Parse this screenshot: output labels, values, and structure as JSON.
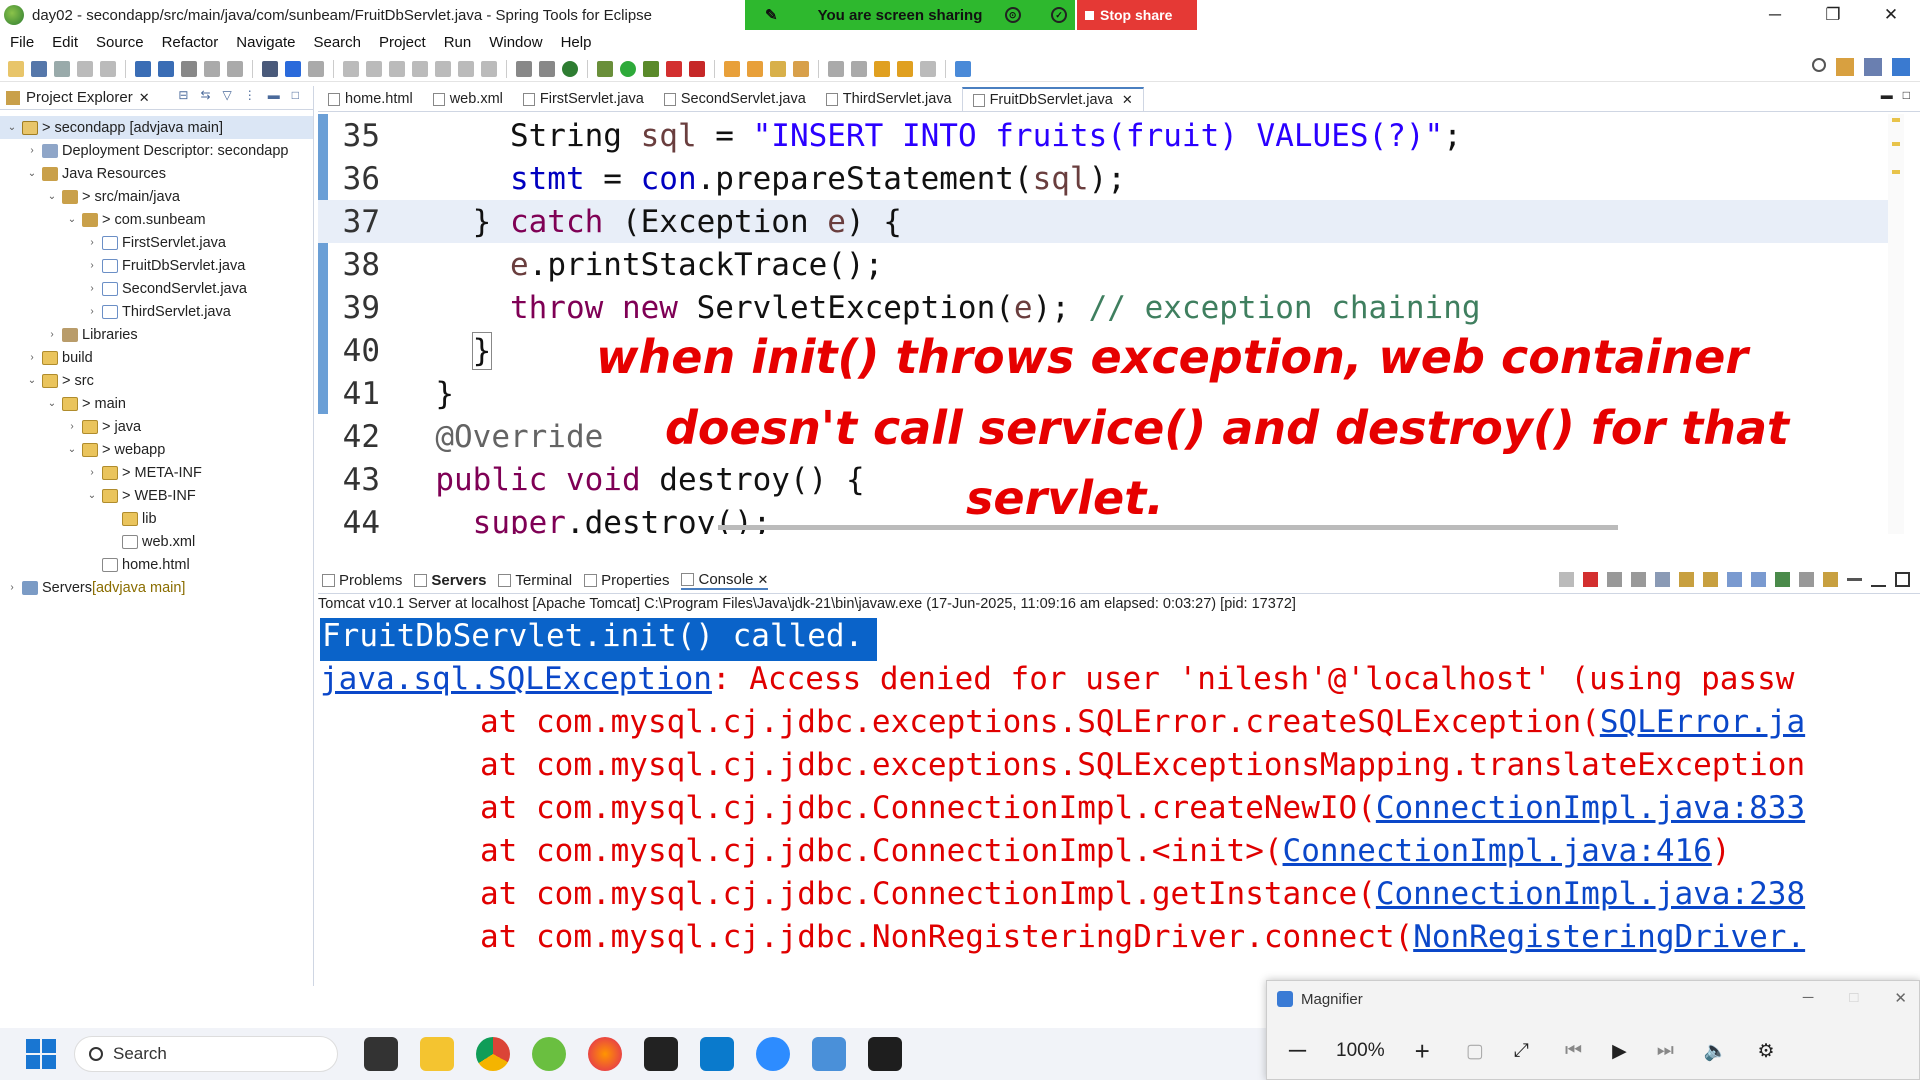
{
  "window": {
    "title": "day02 - secondapp/src/main/java/com/sunbeam/FruitDbServlet.java - Spring Tools for Eclipse",
    "controls": {
      "minimize": "─",
      "maximize": "❐",
      "close": "✕"
    }
  },
  "share_banner": {
    "text": "You are screen sharing",
    "stop_label": "Stop share",
    "color": "#2eb82e",
    "stop_color": "#e53935"
  },
  "menu": [
    "File",
    "Edit",
    "Source",
    "Refactor",
    "Navigate",
    "Search",
    "Project",
    "Run",
    "Window",
    "Help"
  ],
  "explorer": {
    "tab_label": "Project Explorer",
    "items": [
      {
        "label": "> secondapp [advjava main]",
        "icon": "project-icon",
        "twisty": "⌄"
      },
      {
        "label": "Deployment Descriptor: secondapp",
        "icon": "descriptor-icon",
        "twisty": "›"
      },
      {
        "label": "Java Resources",
        "icon": "java-resources-icon",
        "twisty": "⌄"
      },
      {
        "label": "> src/main/java",
        "icon": "source-folder-icon",
        "twisty": "⌄"
      },
      {
        "label": "> com.sunbeam",
        "icon": "package-icon",
        "twisty": "⌄"
      },
      {
        "label": "FirstServlet.java",
        "icon": "java-file-icon",
        "twisty": "›"
      },
      {
        "label": "FruitDbServlet.java",
        "icon": "java-file-icon",
        "twisty": "›"
      },
      {
        "label": "SecondServlet.java",
        "icon": "java-file-icon",
        "twisty": "›"
      },
      {
        "label": "ThirdServlet.java",
        "icon": "java-file-icon",
        "twisty": "›"
      },
      {
        "label": "Libraries",
        "icon": "library-icon",
        "twisty": "›"
      },
      {
        "label": "build",
        "icon": "folder-icon",
        "twisty": "›"
      },
      {
        "label": "> src",
        "icon": "folder-icon",
        "twisty": "⌄"
      },
      {
        "label": "> main",
        "icon": "folder-icon",
        "twisty": "⌄"
      },
      {
        "label": "> java",
        "icon": "folder-icon",
        "twisty": "›"
      },
      {
        "label": "> webapp",
        "icon": "folder-icon",
        "twisty": "⌄"
      },
      {
        "label": "> META-INF",
        "icon": "folder-icon",
        "twisty": "›"
      },
      {
        "label": "> WEB-INF",
        "icon": "folder-icon",
        "twisty": "⌄"
      },
      {
        "label": "lib",
        "icon": "folder-icon",
        "twisty": ""
      },
      {
        "label": "web.xml",
        "icon": "xml-file-icon",
        "twisty": ""
      },
      {
        "label": "home.html",
        "icon": "html-file-icon",
        "twisty": ""
      },
      {
        "label": "Servers",
        "decor": " [advjava main]",
        "icon": "servers-icon",
        "twisty": "›"
      }
    ]
  },
  "editor": {
    "tabs": [
      {
        "label": "home.html",
        "active": false
      },
      {
        "label": "web.xml",
        "active": false
      },
      {
        "label": "FirstServlet.java",
        "active": false
      },
      {
        "label": "SecondServlet.java",
        "active": false
      },
      {
        "label": "ThirdServlet.java",
        "active": false
      },
      {
        "label": "FruitDbServlet.java",
        "active": true
      }
    ],
    "line_numbers": [
      "35",
      "36",
      "37",
      "38",
      "39",
      "40",
      "41",
      "42",
      "43",
      "44"
    ],
    "annotation": {
      "line1": "when init() throws exception, web container",
      "line2": "doesn't call service() and destroy() for that",
      "line3": "servlet."
    }
  },
  "console_panel": {
    "tabs": [
      "Problems",
      "Servers",
      "Terminal",
      "Properties",
      "Console"
    ],
    "description": "Tomcat v10.1 Server at localhost [Apache Tomcat] C:\\Program Files\\Java\\jdk-21\\bin\\javaw.exe  (17-Jun-2025, 11:09:16 am elapsed: 0:03:27) [pid: 17372]",
    "lines": {
      "l0": "FruitDbServlet.init() called.",
      "l1_link": "java.sql.SQLException",
      "l1_text": ": Access denied for user 'nilesh'@'localhost' (using passw",
      "l2_text": "at com.mysql.cj.jdbc.exceptions.SQLError.createSQLException(",
      "l2_link": "SQLError.ja",
      "l3_text": "at com.mysql.cj.jdbc.exceptions.SQLExceptionsMapping.translateException",
      "l4_text": "at com.mysql.cj.jdbc.ConnectionImpl.createNewIO(",
      "l4_link": "ConnectionImpl.java:833",
      "l5_text": "at com.mysql.cj.jdbc.ConnectionImpl.<init>(",
      "l5_link": "ConnectionImpl.java:416",
      "l5_end": ")",
      "l6_text": "at com.mysql.cj.jdbc.ConnectionImpl.getInstance(",
      "l6_link": "ConnectionImpl.java:238",
      "l7_text": "at com.mysql.cj.jdbc.NonRegisteringDriver.connect(",
      "l7_link": "NonRegisteringDriver."
    }
  },
  "magnifier": {
    "title": "Magnifier",
    "zoom": "100%"
  },
  "taskbar": {
    "search_placeholder": "Search"
  }
}
